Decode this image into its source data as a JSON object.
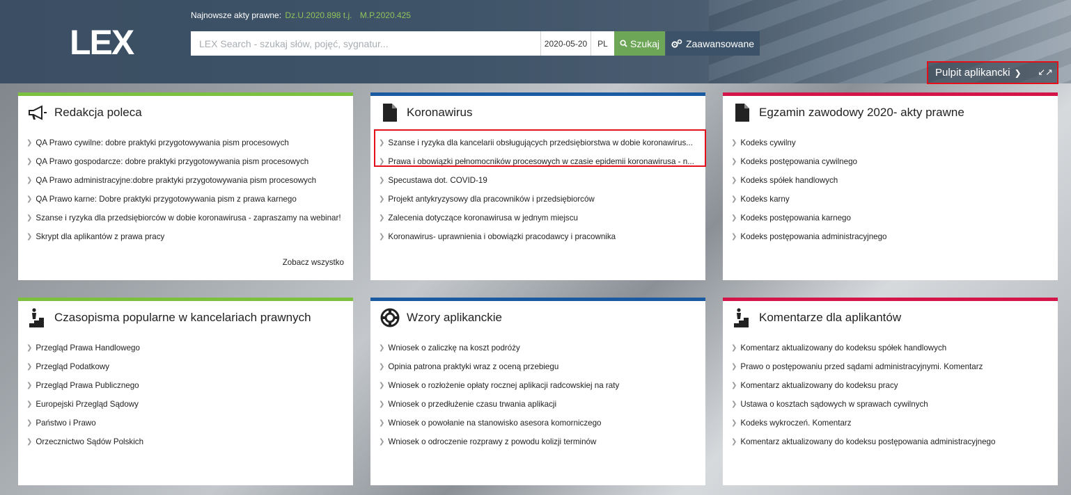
{
  "header": {
    "logo": "LEX",
    "latest_label": "Najnowsze akty prawne:",
    "latest_acts": [
      "Dz.U.2020.898 t.j.",
      "M.P.2020.425"
    ],
    "search_placeholder": "LEX Search - szukaj słów, pojęć, sygnatur...",
    "date": "2020-05-20",
    "lang": "PL",
    "search_label": "Szukaj",
    "advanced_label": "Zaawansowane",
    "desk_label": "Pulpit aplikancki"
  },
  "colors": {
    "green": "#7cc13e",
    "blue": "#1a5aa0",
    "red": "#d4154a",
    "search_btn": "#6da656"
  },
  "cards": [
    {
      "title": "Redakcja poleca",
      "icon": "megaphone-icon",
      "items": [
        "QA Prawo cywilne: dobre praktyki przygotowywania pism procesowych",
        "QA Prawo gospodarcze: dobre praktyki przygotowywania pism procesowych",
        "QA Prawo administracyjne:dobre praktyki przygotowywania pism procesowych",
        "QA Prawo karne: Dobre praktyki przygotowywania pism z prawa karnego",
        "Szanse i ryzyka dla przedsiębiorców w dobie koronawirusa - zapraszamy na webinar!",
        "Skrypt dla aplikantów z prawa pracy"
      ],
      "see_all": "Zobacz wszystko"
    },
    {
      "title": "Koronawirus",
      "icon": "document-icon",
      "items": [
        "Szanse i ryzyka dla kancelarii obsługujących przedsiębiorstwa w dobie koronawirus...",
        "Prawa i obowiązki pełnomocników procesowych w czasie epidemii koronawirusa - n...",
        "Specustawa dot. COVID-19",
        "Projekt antykryzysowy dla pracowników i przedsiębiorców",
        "Zalecenia dotyczące koronawirusa w jednym miejscu",
        "Koronawirus- uprawnienia i obowiązki pracodawcy i pracownika"
      ]
    },
    {
      "title": "Egzamin zawodowy 2020- akty prawne",
      "icon": "document-icon",
      "items": [
        "Kodeks cywilny",
        "Kodeks postępowania cywilnego",
        "Kodeks spółek handlowych",
        "Kodeks karny",
        "Kodeks postępowania karnego",
        "Kodeks postępowania administracyjnego"
      ]
    },
    {
      "title": "Czasopisma popularne w kancelariach prawnych",
      "icon": "stairs-person-icon",
      "items": [
        "Przegląd Prawa Handlowego",
        "Przegląd Podatkowy",
        "Przegląd Prawa Publicznego",
        "Europejski Przegląd Sądowy",
        "Państwo i Prawo",
        "Orzecznictwo Sądów Polskich"
      ]
    },
    {
      "title": "Wzory aplikanckie",
      "icon": "lifebuoy-icon",
      "items": [
        "Wniosek o zaliczkę na koszt podróży",
        "Opinia patrona praktyki wraz z oceną przebiegu",
        "Wniosek o rozłożenie opłaty rocznej aplikacji radcowskiej na raty",
        "Wniosek o przedłużenie czasu trwania aplikacji",
        "Wniosek o powołanie na stanowisko asesora komorniczego",
        "Wniosek o odroczenie rozprawy z powodu kolizji terminów"
      ]
    },
    {
      "title": "Komentarze dla aplikantów",
      "icon": "stairs-person-icon",
      "items": [
        "Komentarz aktualizowany do kodeksu spółek handlowych",
        "Prawo o postępowaniu przed sądami administracyjnymi. Komentarz",
        "Komentarz aktualizowany do kodeksu pracy",
        "Ustawa o kosztach sądowych w sprawach cywilnych",
        "Kodeks wykroczeń. Komentarz",
        "Komentarz aktualizowany do kodeksu postępowania administracyjnego"
      ]
    }
  ]
}
